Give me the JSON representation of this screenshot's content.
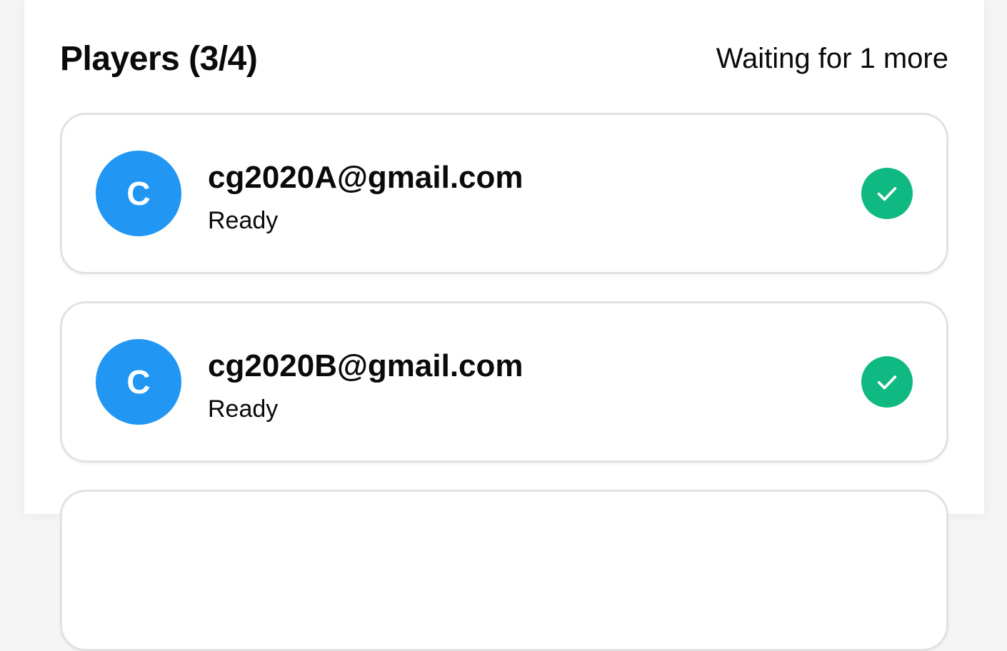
{
  "header": {
    "title": "Players (3/4)",
    "waiting_text": "Waiting for 1 more"
  },
  "players": [
    {
      "avatar_letter": "C",
      "email": "cg2020A@gmail.com",
      "status": "Ready",
      "ready_icon": "check-icon"
    },
    {
      "avatar_letter": "C",
      "email": "cg2020B@gmail.com",
      "status": "Ready",
      "ready_icon": "check-icon"
    }
  ],
  "colors": {
    "avatar": "#2196f3",
    "ready": "#10b981",
    "card_border": "#e2e2e2"
  }
}
